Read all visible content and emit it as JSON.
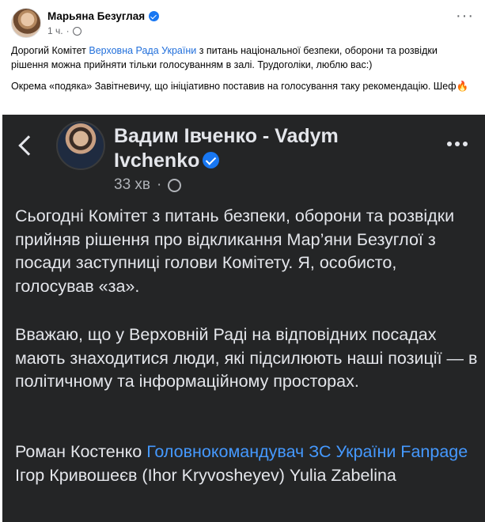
{
  "post": {
    "author": "Марьяна Безуглая",
    "time": "1 ч.",
    "dot": "·",
    "more": "···",
    "p1_before": "Дорогий Комітет ",
    "p1_link": "Верховна Рада України",
    "p1_after": " з питань національної безпеки, оборони та розвідки рішення можна прийняти тільки голосуванням в залі. Трудоголіки, люблю вас:)",
    "p2": "Окрема «подяка» Завітневичу, що ініціативно поставив на голосування таку рекомендацію. Шеф",
    "p2_emoji": "🔥"
  },
  "screenshot": {
    "author": "Вадим Івченко - Vadym Ivchenko",
    "time": "33 хв",
    "dot": "·",
    "paragraph1": "Сьогодні Комітет з питань безпеки, оборони та розвідки прийняв рішення про відкликання Мар’яни Безуглої з посади заступниці голови Комітету. Я, особисто, голосував «за».",
    "paragraph2": "Вважаю, що у Верховній Раді на відповідних посадах мають знаходитися люди, які підсилюють наші позиції — в політичному та інформаційному просторах.",
    "tag_plain1": "Роман Костенко ",
    "tag_link1": "Головнокомандувач ЗС України Fanpage",
    "tag_plain2": " Ігор Кривошеєв (Ihor Kryvosheyev) Yulia Zabelina"
  },
  "icons": [
    "verified-badge",
    "globe-icon",
    "more-icon",
    "back-chevron-icon"
  ],
  "colors": {
    "link": "#216fdb",
    "dark_bg": "#242526",
    "dark_link": "#4599ff",
    "verified": "#1877f2"
  }
}
